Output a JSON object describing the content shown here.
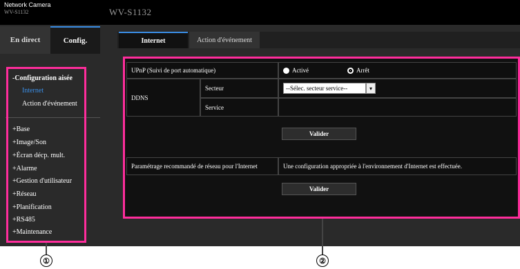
{
  "header": {
    "brand": "Network Camera",
    "brand_sub": "WV-S1132",
    "camera_id": "WV-S1132"
  },
  "sidebar": {
    "tab_live": "En direct",
    "tab_config": "Config.",
    "section_title": "-Configuration aisée",
    "items": [
      {
        "label": "Internet"
      },
      {
        "label": "Action d'événement"
      },
      {
        "label": "+Base"
      },
      {
        "label": "+Image/Son"
      },
      {
        "label": "+Écran décp. mult."
      },
      {
        "label": "+Alarme"
      },
      {
        "label": "+Gestion d'utilisateur"
      },
      {
        "label": "+Réseau"
      },
      {
        "label": "+Planification"
      },
      {
        "label": "+RS485"
      },
      {
        "label": "+Maintenance"
      }
    ]
  },
  "tabs": {
    "internet": "Internet",
    "event": "Action d'événement"
  },
  "form": {
    "upnp_label": "UPnP (Suivi de port automatique)",
    "upnp_on": "Activé",
    "upnp_off": "Arrêt",
    "ddns_label": "DDNS",
    "sector_label": "Secteur",
    "sector_value": "--Sélec. secteur service--",
    "service_label": "Service",
    "validate_1": "Valider",
    "recommended_label": "Paramétrage recommandé de réseau pour l'Internet",
    "recommended_desc": "Une configuration appropriée à l'environnement d'Internet est effectuée.",
    "validate_2": "Valider"
  },
  "callouts": {
    "one": "①",
    "two": "②"
  }
}
